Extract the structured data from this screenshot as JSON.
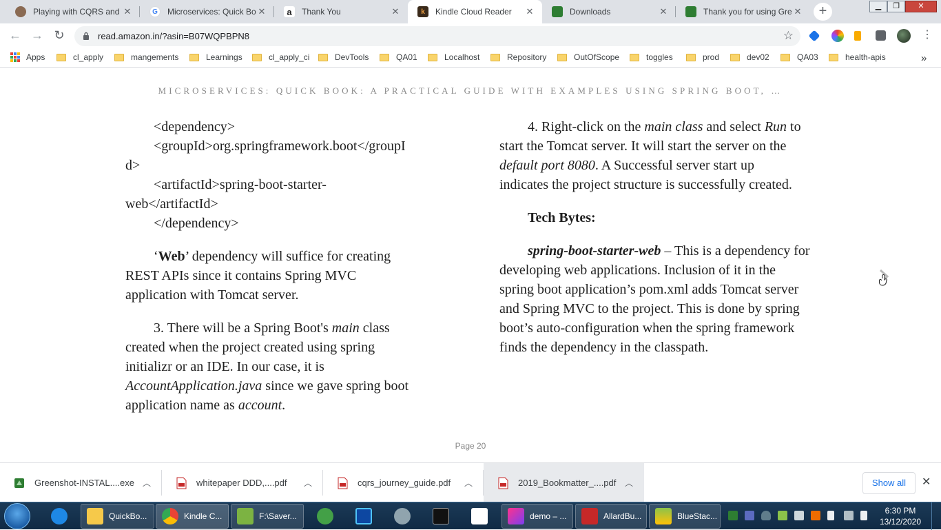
{
  "browser": {
    "tabs": [
      {
        "title": "Playing with CQRS and E",
        "favicon": "avatar-icon",
        "active": false
      },
      {
        "title": "Microservices: Quick Boo",
        "favicon": "google-icon",
        "active": false
      },
      {
        "title": "Thank You",
        "favicon": "amazon-icon",
        "active": false
      },
      {
        "title": "Kindle Cloud Reader",
        "favicon": "kindle-icon",
        "active": true
      },
      {
        "title": "Downloads",
        "favicon": "greenshot-icon",
        "active": false
      },
      {
        "title": "Thank you for using Gre",
        "favicon": "greenshot-icon",
        "active": false
      }
    ],
    "url": "read.amazon.in/?asin=B07WQPBPN8",
    "bookmarks": [
      "Apps",
      "cl_apply",
      "mangements",
      "Learnings",
      "cl_apply_ci",
      "DevTools",
      "QA01",
      "Localhost",
      "Repository",
      "OutOfScope",
      "toggles",
      "prod",
      "dev02",
      "QA03",
      "health-apis"
    ],
    "more_bookmarks": "»"
  },
  "reader": {
    "book_title": "MICROSERVICES: QUICK BOOK: A PRACTICAL GUIDE WITH EXAMPLES USING SPRING BOOT, …",
    "page_label": "Page 20",
    "left": {
      "code_dependency_open": "<dependency>",
      "code_groupid_a": "<groupId>org.springframework.boot</groupI",
      "code_groupid_b": "d>",
      "code_artifact_a": "<artifactId>spring-boot-starter-",
      "code_artifact_b": "web</artifactId>",
      "code_dependency_close": "</dependency>",
      "p1_q_open": "‘",
      "p1_bold": "Web",
      "p1_rest": "’ dependency will suffice for creating REST APIs since it contains Spring MVC application with Tomcat server.",
      "p2_a": "3. There will be a Spring Boot's ",
      "p2_main": "main",
      "p2_b": " class created when the project created using spring initializr or an IDE. In our case, it is ",
      "p2_app": "AccountApplication.java",
      "p2_c": " since we gave spring boot application name as ",
      "p2_account": "account",
      "p2_d": "."
    },
    "right": {
      "p1_a": "4. Right-click on the ",
      "p1_mainclass": "main class",
      "p1_b": " and select ",
      "p1_run": "Run",
      "p1_c": " to start the Tomcat server. It will start the server on the ",
      "p1_port": "default port 8080",
      "p1_d": ". A Successful server start up indicates the project structure is successfully created.",
      "heading": "Tech Bytes:",
      "p2_term": "spring-boot-starter-web",
      "p2_rest": " – This is a dependency for developing web applications. Inclusion of it in the spring boot application’s pom.xml adds Tomcat server and Spring MVC to the project. This is done by spring boot’s auto-configuration when the spring framework finds the dependency in the classpath."
    }
  },
  "downloads": {
    "items": [
      "Greenshot-INSTAL....exe",
      "whitepaper DDD,....pdf",
      "cqrs_journey_guide.pdf",
      "2019_Bookmatter_....pdf"
    ],
    "show_all": "Show all"
  },
  "taskbar": {
    "items": [
      "QuickBo...",
      "Kindle C...",
      "F:\\Saver...",
      "demo – ...",
      "AllardBu...",
      "BlueStac..."
    ],
    "time": "6:30 PM",
    "date": "13/12/2020"
  }
}
